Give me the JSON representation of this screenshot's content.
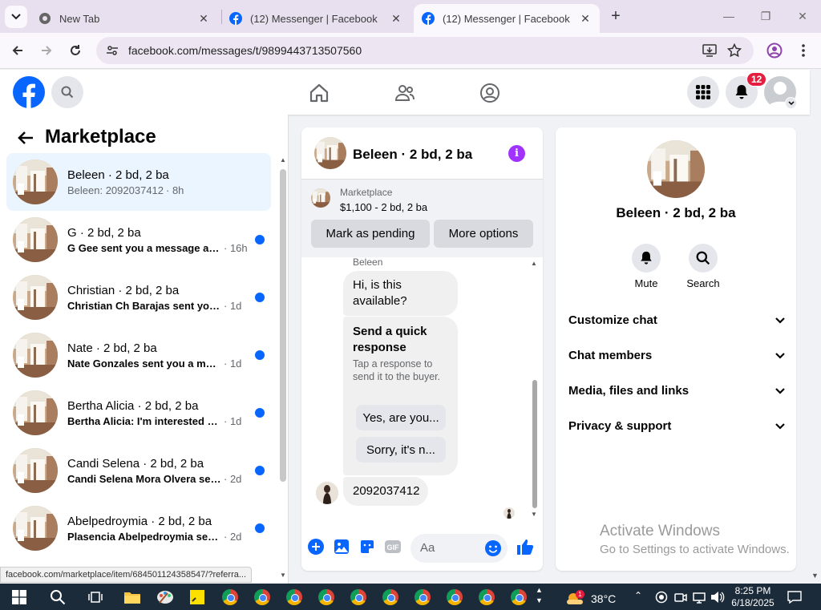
{
  "browser": {
    "tabs": [
      {
        "title": "New Tab"
      },
      {
        "title": "(12) Messenger | Facebook"
      },
      {
        "title": "(12) Messenger | Facebook"
      }
    ],
    "url": "facebook.com/messages/t/9899443713507560",
    "status_url": "facebook.com/marketplace/item/684501124358547/?referra..."
  },
  "fb_header": {
    "notification_count": "12"
  },
  "left_panel": {
    "title": "Marketplace",
    "conversations": [
      {
        "name": "Beleen · 2 bd, 2 ba",
        "preview": "Beleen: 2092037412",
        "time": "· 8h",
        "selected": true,
        "unread": false
      },
      {
        "name": "G · 2 bd, 2 ba",
        "preview": "G Gee sent you a message abo...",
        "time": "· 16h",
        "selected": false,
        "unread": true
      },
      {
        "name": "Christian · 2 bd, 2 ba",
        "preview": "Christian Ch Barajas sent you a ...",
        "time": "· 1d",
        "selected": false,
        "unread": true
      },
      {
        "name": "Nate · 2 bd, 2 ba",
        "preview": "Nate Gonzales sent you a messa...",
        "time": "· 1d",
        "selected": false,
        "unread": true
      },
      {
        "name": "Bertha Alicia · 2 bd, 2 ba",
        "preview": "Bertha Alicia: I'm interested my ...",
        "time": "· 1d",
        "selected": false,
        "unread": true
      },
      {
        "name": "Candi Selena · 2 bd, 2 ba",
        "preview": "Candi Selena Mora Olvera sent ...",
        "time": "· 2d",
        "selected": false,
        "unread": true
      },
      {
        "name": "Abelpedroymia · 2 bd, 2 ba",
        "preview": "Plasencia Abelpedroymia sent y...",
        "time": "· 2d",
        "selected": false,
        "unread": true
      }
    ]
  },
  "chat": {
    "title": "Beleen · 2 bd, 2 ba",
    "listing_label": "Marketplace",
    "listing_detail": "$1,100 - 2 bd, 2 ba",
    "mark_pending": "Mark as pending",
    "more_options": "More options",
    "sender_label": "Beleen",
    "msg1": "Hi, is this available?",
    "quick_title": "Send a quick response",
    "quick_sub": "Tap a response to send it to the buyer.",
    "quick_replies": [
      "Yes, are you...",
      "Sorry, it's n..."
    ],
    "msg2": "2092037412",
    "composer_placeholder": "Aa"
  },
  "right_panel": {
    "title": "Beleen · 2 bd, 2 ba",
    "actions": [
      {
        "label": "Mute",
        "icon": "bell-icon"
      },
      {
        "label": "Search",
        "icon": "search-icon"
      }
    ],
    "sections": [
      "Customize chat",
      "Chat members",
      "Media, files and links",
      "Privacy & support"
    ]
  },
  "watermark": {
    "line1": "Activate Windows",
    "line2": "Go to Settings to activate Windows."
  },
  "taskbar": {
    "weather_badge": "1",
    "temperature": "38°C",
    "time": "8:25 PM",
    "date": "6/18/2025"
  },
  "colors": {
    "fb_blue": "#0866ff",
    "messenger_purple": "#a033ff",
    "notification_red": "#e41e3f",
    "selected_bg": "#ebf5ff"
  }
}
